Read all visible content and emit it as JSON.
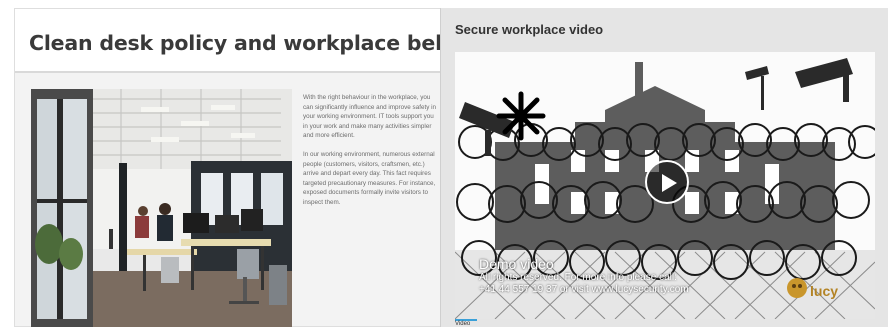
{
  "left": {
    "title": "Clean desk policy and workplace behaviour",
    "paragraphs": [
      "With the right behaviour in the workplace, you can significantly influence and improve safety in your working environment. IT tools support you in your work and make many activities simpler and more efficient.",
      "In our working environment, numerous external people (customers, visitors, craftsmen, etc.) arrive and depart every day. This fact requires targeted precautionary measures. For instance, exposed documents formally invite visitors to inspect them."
    ],
    "photo_icon": "office-photo"
  },
  "right": {
    "title": "Secure workplace video",
    "video": {
      "caption_title": "Demo video",
      "caption_lines": [
        "All rights reserved. For more info please call:",
        "+41 44 557 19 37 or visit www.lucysecurity.com"
      ],
      "logo_text": "lucy",
      "play_icon": "play-icon"
    },
    "tab_label": "Video"
  },
  "colors": {
    "accent": "#3aa0d8",
    "title_text": "#3a3a3a",
    "body_text": "#6c6c6c",
    "panel_bg": "#e5e5e5"
  }
}
